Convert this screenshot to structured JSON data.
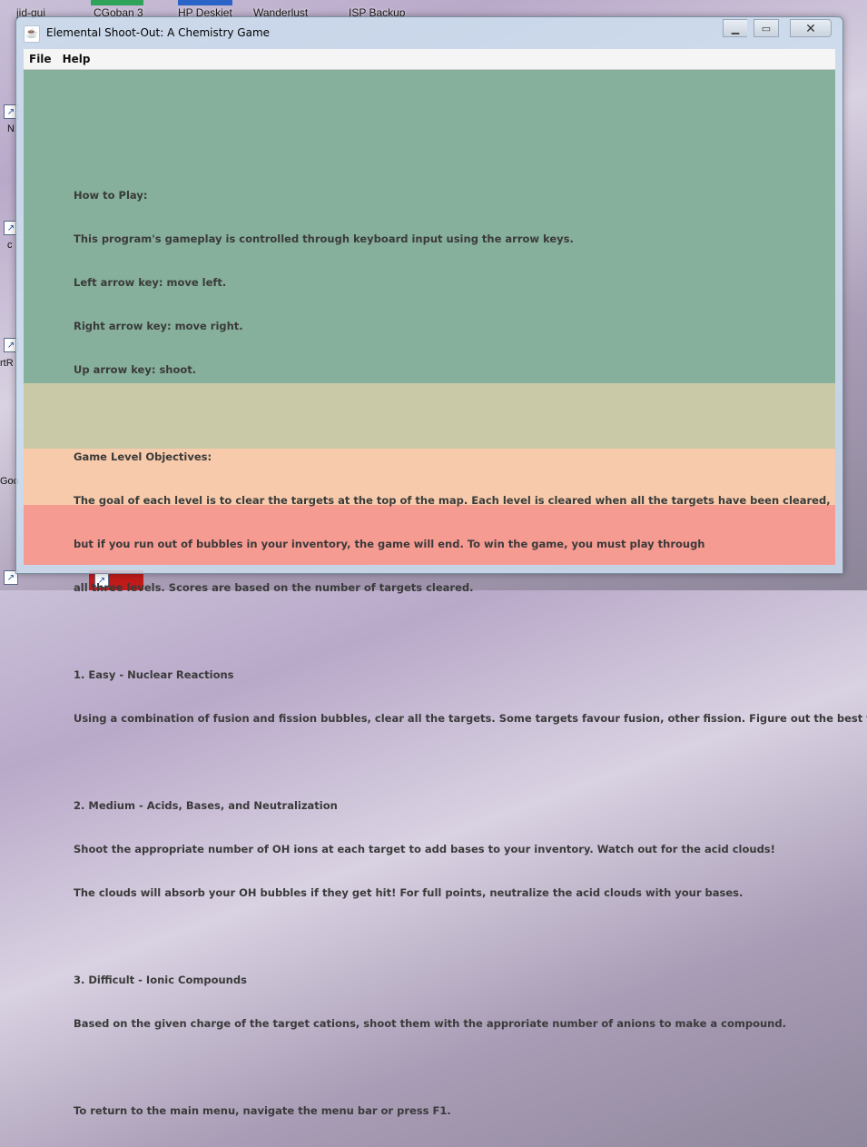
{
  "desktop": {
    "icons": [
      {
        "label": "jid-gui"
      },
      {
        "label": "CGoban 3"
      },
      {
        "label": "HP Deskjet"
      },
      {
        "label": "Wanderlust"
      },
      {
        "label": "ISP Backup"
      }
    ],
    "left_partial_labels": [
      "N",
      "c",
      "rtR",
      "Goo"
    ]
  },
  "window": {
    "title": "Elemental Shoot-Out: A Chemistry Game",
    "app_icon": "java-icon",
    "controls": {
      "minimize": "minimize-icon",
      "maximize": "maximize-icon",
      "close": "close-icon"
    }
  },
  "menubar": {
    "items": [
      {
        "label": "File"
      },
      {
        "label": "Help"
      }
    ]
  },
  "help_text": {
    "lines": [
      "How to Play:",
      "This program's gameplay is controlled through keyboard input using the arrow keys.",
      "Left arrow key: move left.",
      "Right arrow key: move right.",
      "Up arrow key: shoot.",
      "",
      "Game Level Objectives:",
      "The goal of each level is to clear the targets at the top of the map. Each level is cleared when all the targets have been cleared,",
      "but if you run out of bubbles in your inventory, the game will end. To win the game, you must play through",
      "all three levels. Scores are based on the number of targets cleared.",
      "",
      "1. Easy - Nuclear Reactions",
      "Using a combination of fusion and fission bubbles, clear all the targets. Some targets favour fusion, other fission. Figure out the best to use!",
      "",
      "2. Medium - Acids, Bases, and Neutralization",
      "Shoot the appropriate number of OH ions at each target to add bases to your inventory. Watch out for the acid clouds!",
      "The clouds will absorb your OH bubbles if they get hit! For full points, neutralize the acid clouds with your bases.",
      "",
      "3. Difficult - Ionic Compounds",
      "Based on the given charge of the target cations, shoot them with the approriate number of anions to make a compound.",
      "",
      "To return to the main menu, navigate the menu bar or press F1."
    ]
  },
  "colors": {
    "band_green": "#86b09c",
    "band_khaki": "#c9c9a8",
    "band_peach": "#f6caaa",
    "band_salmon": "#f69b92",
    "text": "#3a3a3a"
  }
}
